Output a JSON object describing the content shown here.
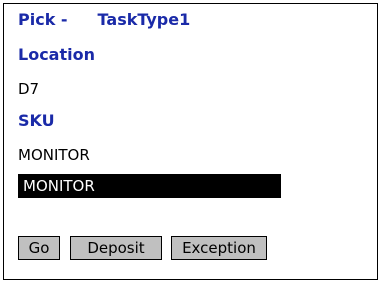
{
  "header": {
    "title_left": "Pick -",
    "title_right": "TaskType1"
  },
  "location": {
    "label": "Location",
    "value": "D7"
  },
  "sku": {
    "label": "SKU",
    "value": "MONITOR",
    "input_value": "MONITOR"
  },
  "actions": {
    "go_label": "Go",
    "deposit_label": "Deposit",
    "exception_label": "Exception"
  },
  "colors": {
    "heading": "#1a2aa8",
    "text": "#000000",
    "input_background": "#000000",
    "input_text": "#ffffff",
    "button_face": "#c0c0c0",
    "background": "#ffffff"
  }
}
